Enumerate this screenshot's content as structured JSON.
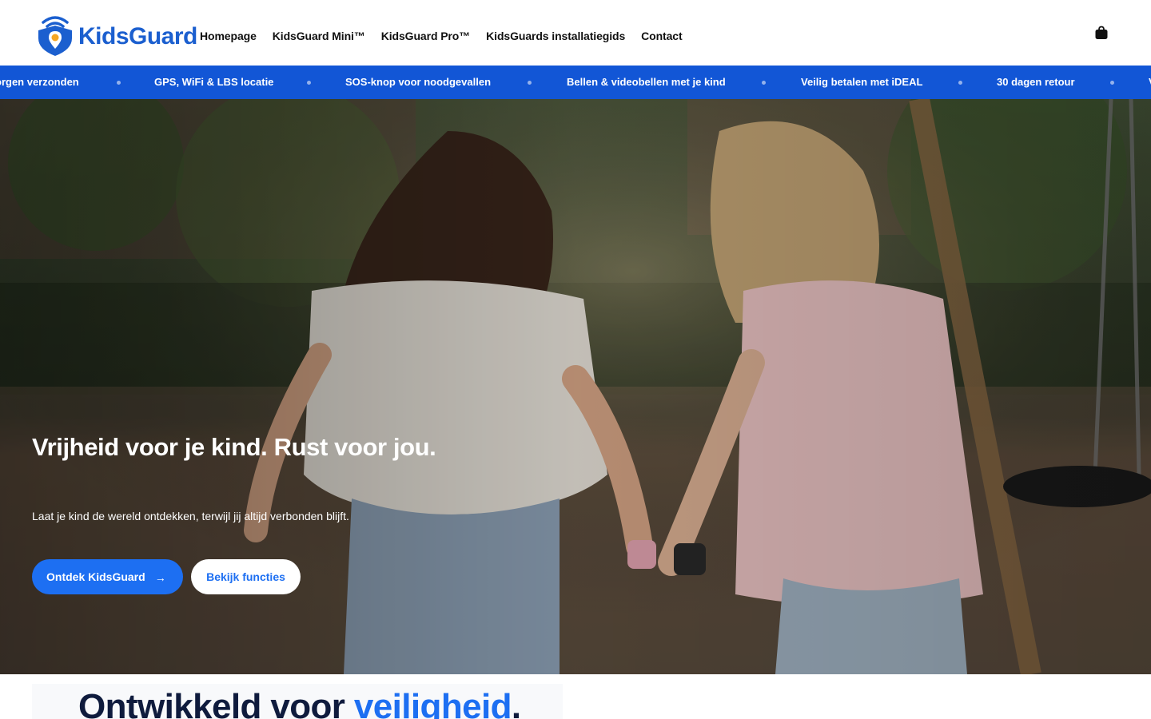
{
  "brand": {
    "name": "KidsGuard",
    "color": "#1b5fcf",
    "accent": "#f5a623"
  },
  "nav": {
    "items": [
      {
        "label": "Homepage"
      },
      {
        "label": "KidsGuard Mini™"
      },
      {
        "label": "KidsGuard Pro™"
      },
      {
        "label": "KidsGuards installatiegids"
      },
      {
        "label": "Contact"
      }
    ],
    "cart_icon": "shopping-bag-icon"
  },
  "ticker": {
    "background": "#1256d6",
    "items": [
      "orgen verzonden",
      "GPS, WiFi & LBS locatie",
      "SOS-knop voor noodgevallen",
      "Bellen & videobellen met je kind",
      "Veilig betalen met iDEAL",
      "30 dagen retour",
      "V"
    ]
  },
  "hero": {
    "title": "Vrijheid voor je kind. Rust voor jou.",
    "subtitle": "Laat je kind de wereld ontdekken, terwijl jij altijd verbonden blijft.",
    "primary_button": {
      "label": "Ontdek KidsGuard",
      "icon": "→"
    },
    "secondary_button": {
      "label": "Bekijk functies"
    },
    "image_description_icon": "photo-children-playground"
  },
  "section": {
    "title_prefix": "Ontwikkeld voor ",
    "title_accent": "veiligheid",
    "title_suffix": "."
  }
}
